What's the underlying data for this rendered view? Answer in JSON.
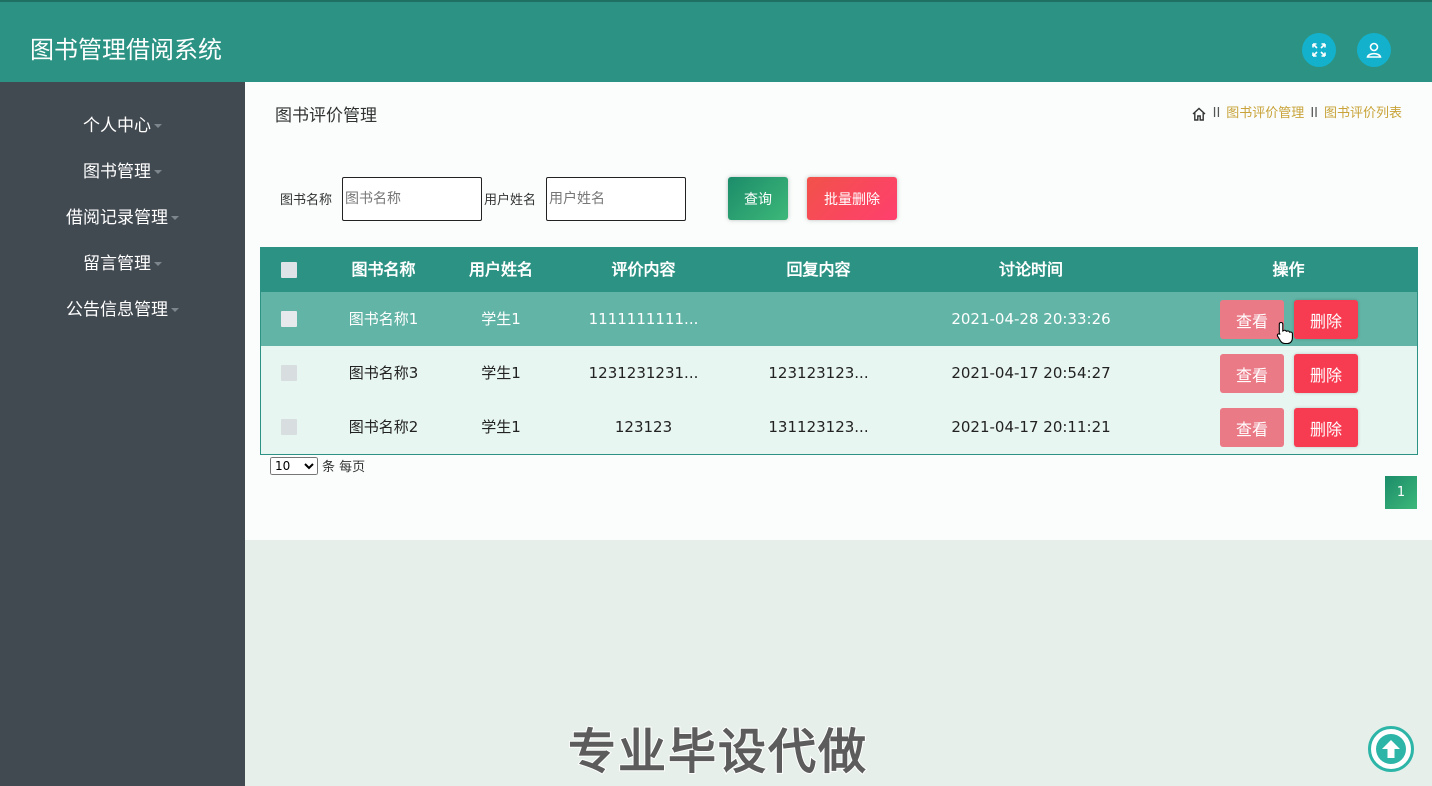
{
  "header": {
    "title": "图书管理借阅系统",
    "colors": {
      "bar": "#2c9384",
      "icon_bg": "#13b1cc"
    }
  },
  "sidebar": {
    "items": [
      {
        "label": "个人中心"
      },
      {
        "label": "图书管理"
      },
      {
        "label": "借阅记录管理"
      },
      {
        "label": "留言管理"
      },
      {
        "label": "公告信息管理"
      }
    ]
  },
  "page": {
    "title": "图书评价管理",
    "breadcrumb": [
      "图书评价管理",
      "图书评价列表"
    ],
    "breadcrumb_sep": "II"
  },
  "search": {
    "book_label": "图书名称",
    "book_placeholder": "图书名称",
    "user_label": "用户姓名",
    "user_placeholder": "用户姓名",
    "query_label": "查询",
    "batch_delete_label": "批量删除"
  },
  "table": {
    "headers": [
      "图书名称",
      "用户姓名",
      "评价内容",
      "回复内容",
      "讨论时间",
      "操作"
    ],
    "rows": [
      {
        "book": "图书名称1",
        "user": "学生1",
        "content": "1111111111...",
        "reply": "",
        "time": "2021-04-28 20:33:26"
      },
      {
        "book": "图书名称3",
        "user": "学生1",
        "content": "1231231231...",
        "reply": "123123123...",
        "time": "2021-04-17 20:54:27"
      },
      {
        "book": "图书名称2",
        "user": "学生1",
        "content": "123123",
        "reply": "131123123...",
        "time": "2021-04-17 20:11:21"
      }
    ],
    "view_label": "查看",
    "delete_label": "删除"
  },
  "pagination": {
    "page_size": "10",
    "page_size_suffix": "条 每页",
    "current_page": "1"
  },
  "watermark": "专业毕设代做"
}
